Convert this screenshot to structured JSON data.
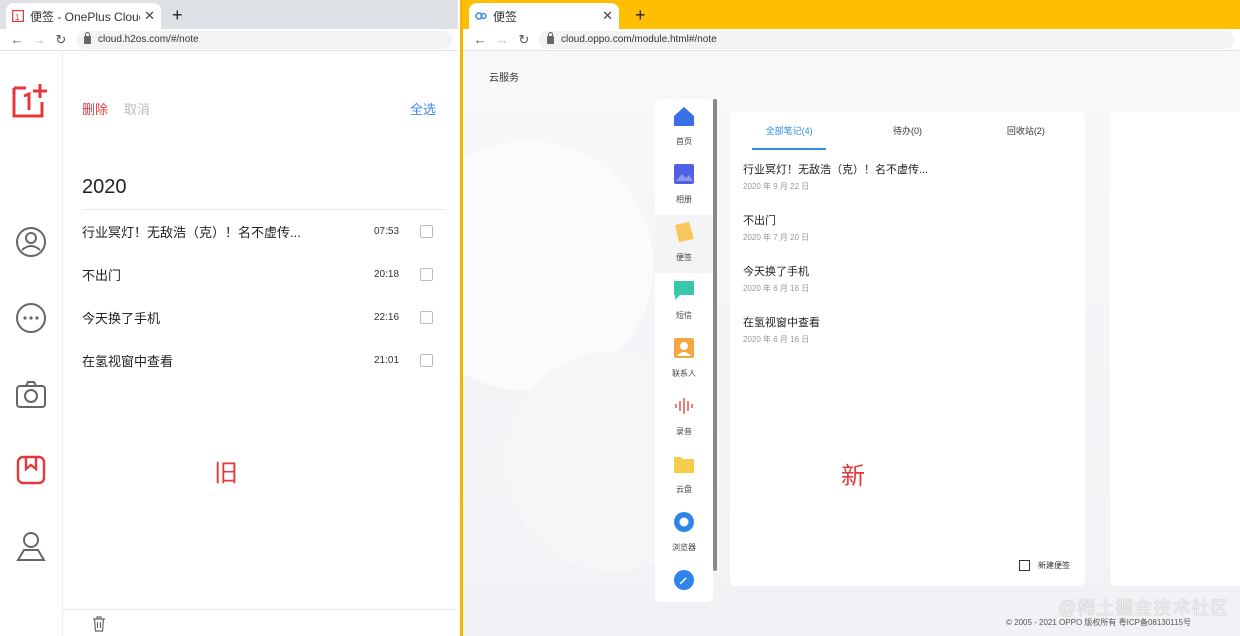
{
  "left_window": {
    "tab_title": "便签 - OnePlus Cloud Bu",
    "url": "cloud.h2os.com/#/note",
    "actions": {
      "delete": "删除",
      "cancel": "取消",
      "select_all": "全选"
    },
    "year": "2020",
    "notes": [
      {
        "title": "行业冥灯！无敌浩（克）！名不虚传...",
        "time": "07:53"
      },
      {
        "title": "不出门",
        "time": "20:18"
      },
      {
        "title": "今天换了手机",
        "time": "22:16"
      },
      {
        "title": "在氢视窗中查看",
        "time": "21:01"
      }
    ],
    "label": "旧"
  },
  "right_window": {
    "tab_title": "便签",
    "url": "cloud.oppo.com/module.html#/note",
    "service": "云服务",
    "sidebar": [
      {
        "label": "首页",
        "color": "#3a6fe8"
      },
      {
        "label": "相册",
        "color": "#5160e6"
      },
      {
        "label": "便签",
        "color": "#f8c65a"
      },
      {
        "label": "短信",
        "color": "#38c9ac"
      },
      {
        "label": "联系人",
        "color": "#f4a640"
      },
      {
        "label": "录音",
        "color": "#e85a5a"
      },
      {
        "label": "云盘",
        "color": "#f5cd4a"
      },
      {
        "label": "浏览器",
        "color": "#2f86e8"
      }
    ],
    "tabs": [
      "全部笔记(4)",
      "待办(0)",
      "回收站(2)"
    ],
    "notes": [
      {
        "title": "行业冥灯！无敌浩（克）！名不虚传...",
        "date": "2020 年 9 月 22 日"
      },
      {
        "title": "不出门",
        "date": "2020 年 7 月 20 日"
      },
      {
        "title": "今天换了手机",
        "date": "2020 年 6 月 16 日"
      },
      {
        "title": "在氢视窗中查看",
        "date": "2020 年 6 月 16 日"
      }
    ],
    "new_note": "新建便签",
    "label": "新",
    "footer": "© 2005 - 2021 OPPO 版权所有 粤ICP备08130115号"
  },
  "watermark": "@稀土掘金技术社区"
}
